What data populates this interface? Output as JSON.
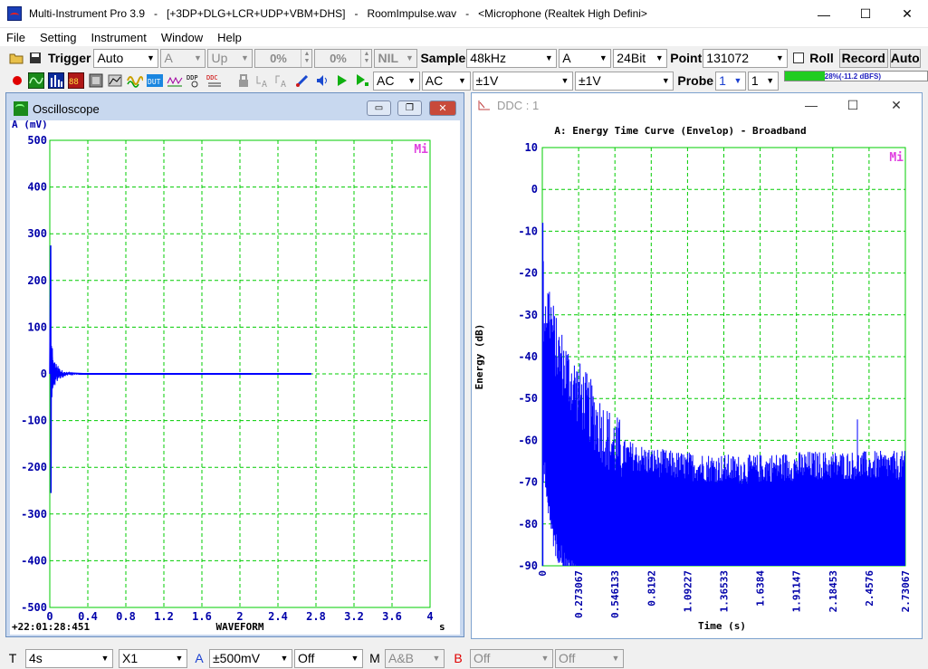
{
  "window": {
    "title": "Multi-Instrument Pro 3.9   -   [+3DP+DLG+LCR+UDP+VBM+DHS]   -   RoomImpulse.wav   -   <Microphone (Realtek High Defini>",
    "minimize": "—",
    "maximize": "☐",
    "close": "✕"
  },
  "menu": [
    "File",
    "Setting",
    "Instrument",
    "Window",
    "Help"
  ],
  "toolbar1": {
    "trigger_label": "Trigger",
    "trigger_mode": "Auto",
    "trigger_channel": "A",
    "trigger_edge": "Up",
    "pct1": "0%",
    "pct2": "0%",
    "nil": "NIL",
    "sample_label": "Sample",
    "sample_rate": "48kHz",
    "channel": "A",
    "bits": "24Bit",
    "point_label": "Point",
    "points": "131072",
    "roll_label": "Roll",
    "record_label": "Record",
    "auto_label": "Auto"
  },
  "toolbar2": {
    "coupling_a": "AC",
    "coupling_b": "AC",
    "range_a": "±1V",
    "range_b": "±1V",
    "probe_label": "Probe",
    "probe_a": "1",
    "probe_b": "1",
    "level_text": "28%(-11.2 dBFS)",
    "level_fraction": 0.28,
    "icon_labels": {
      "dut": "DUT",
      "ddp": "DDP",
      "ddc": "DDC",
      "ta": "A",
      "tb": "A"
    }
  },
  "oscilloscope": {
    "title": "Oscilloscope",
    "unit_label": "A (mV)",
    "mi_logo": "Mi",
    "timestamp": "+22:01:28:451",
    "xlabel": "WAVEFORM",
    "x_unit": "s",
    "min_btn": "▭",
    "max_btn": "❐",
    "close_btn": "✕"
  },
  "ddc": {
    "title": "DDC : 1",
    "plot_title": "A: Energy Time Curve (Envelop) - Broadband",
    "ylabel": "Energy (dB)",
    "xlabel": "Time (s)",
    "mi_logo": "Mi",
    "minimize": "—",
    "maximize": "☐",
    "close": "✕"
  },
  "statusbar": {
    "t_label": "T",
    "timebase": "4s",
    "zoom": "X1",
    "a_label": "A",
    "a_range": "±500mV",
    "a_offset": "Off",
    "m_label": "M",
    "math": "A&B",
    "b_label": "B",
    "b_range": "Off",
    "b_offset": "Off"
  },
  "colors": {
    "grid": "#00cc00",
    "trace": "#0000ff",
    "axis_text": "#0000aa",
    "mi_logo": "#e040e0",
    "level_fill": "#22cc22"
  },
  "chart_data": [
    {
      "type": "line",
      "name": "oscilloscope",
      "xlim": [
        0,
        4
      ],
      "ylim": [
        -500,
        500
      ],
      "xticks": [
        "0",
        "0.4",
        "0.8",
        "1.2",
        "1.6",
        "2",
        "2.4",
        "2.8",
        "3.2",
        "3.6",
        "4"
      ],
      "yticks": [
        "500",
        "400",
        "300",
        "200",
        "100",
        "0",
        "-100",
        "-200",
        "-300",
        "-400",
        "-500"
      ],
      "grid": true,
      "signal_end": 2.75,
      "series": [
        {
          "x": [
            0,
            0.01,
            0.012,
            0.015,
            0.02,
            0.025,
            0.03,
            0.04,
            0.05,
            0.06,
            0.08,
            0.1,
            0.15,
            0.2,
            0.3,
            0.4,
            2.75
          ],
          "y": [
            0,
            275,
            -255,
            60,
            -50,
            55,
            -30,
            20,
            -15,
            10,
            -8,
            5,
            -3,
            2,
            1,
            0,
            0
          ]
        }
      ]
    },
    {
      "type": "line",
      "name": "etc",
      "xlim": [
        0,
        2.73067
      ],
      "ylim": [
        -90,
        10
      ],
      "xticks": [
        "0",
        "0.273067",
        "0.546133",
        "0.8192",
        "1.09227",
        "1.36533",
        "1.6384",
        "1.91147",
        "2.18453",
        "2.4576",
        "2.73067"
      ],
      "yticks": [
        "10",
        "0",
        "-10",
        "-20",
        "-30",
        "-40",
        "-50",
        "-60",
        "-70",
        "-80",
        "-90"
      ],
      "grid": true,
      "envelope": {
        "x": [
          0,
          0.01,
          0.05,
          0.1,
          0.2,
          0.3,
          0.4,
          0.5,
          0.6,
          0.8,
          1.0,
          1.5,
          2.0,
          2.4,
          2.73067
        ],
        "upper": [
          -8,
          -30,
          -28,
          -38,
          -45,
          -50,
          -55,
          -60,
          -63,
          -65,
          -66,
          -67,
          -66,
          -66,
          -66
        ],
        "lower": [
          -90,
          -60,
          -75,
          -82,
          -88,
          -90,
          -90,
          -90,
          -90,
          -90,
          -90,
          -90,
          -90,
          -90,
          -90
        ]
      },
      "spike": {
        "x": 2.37,
        "y": -55
      }
    }
  ]
}
